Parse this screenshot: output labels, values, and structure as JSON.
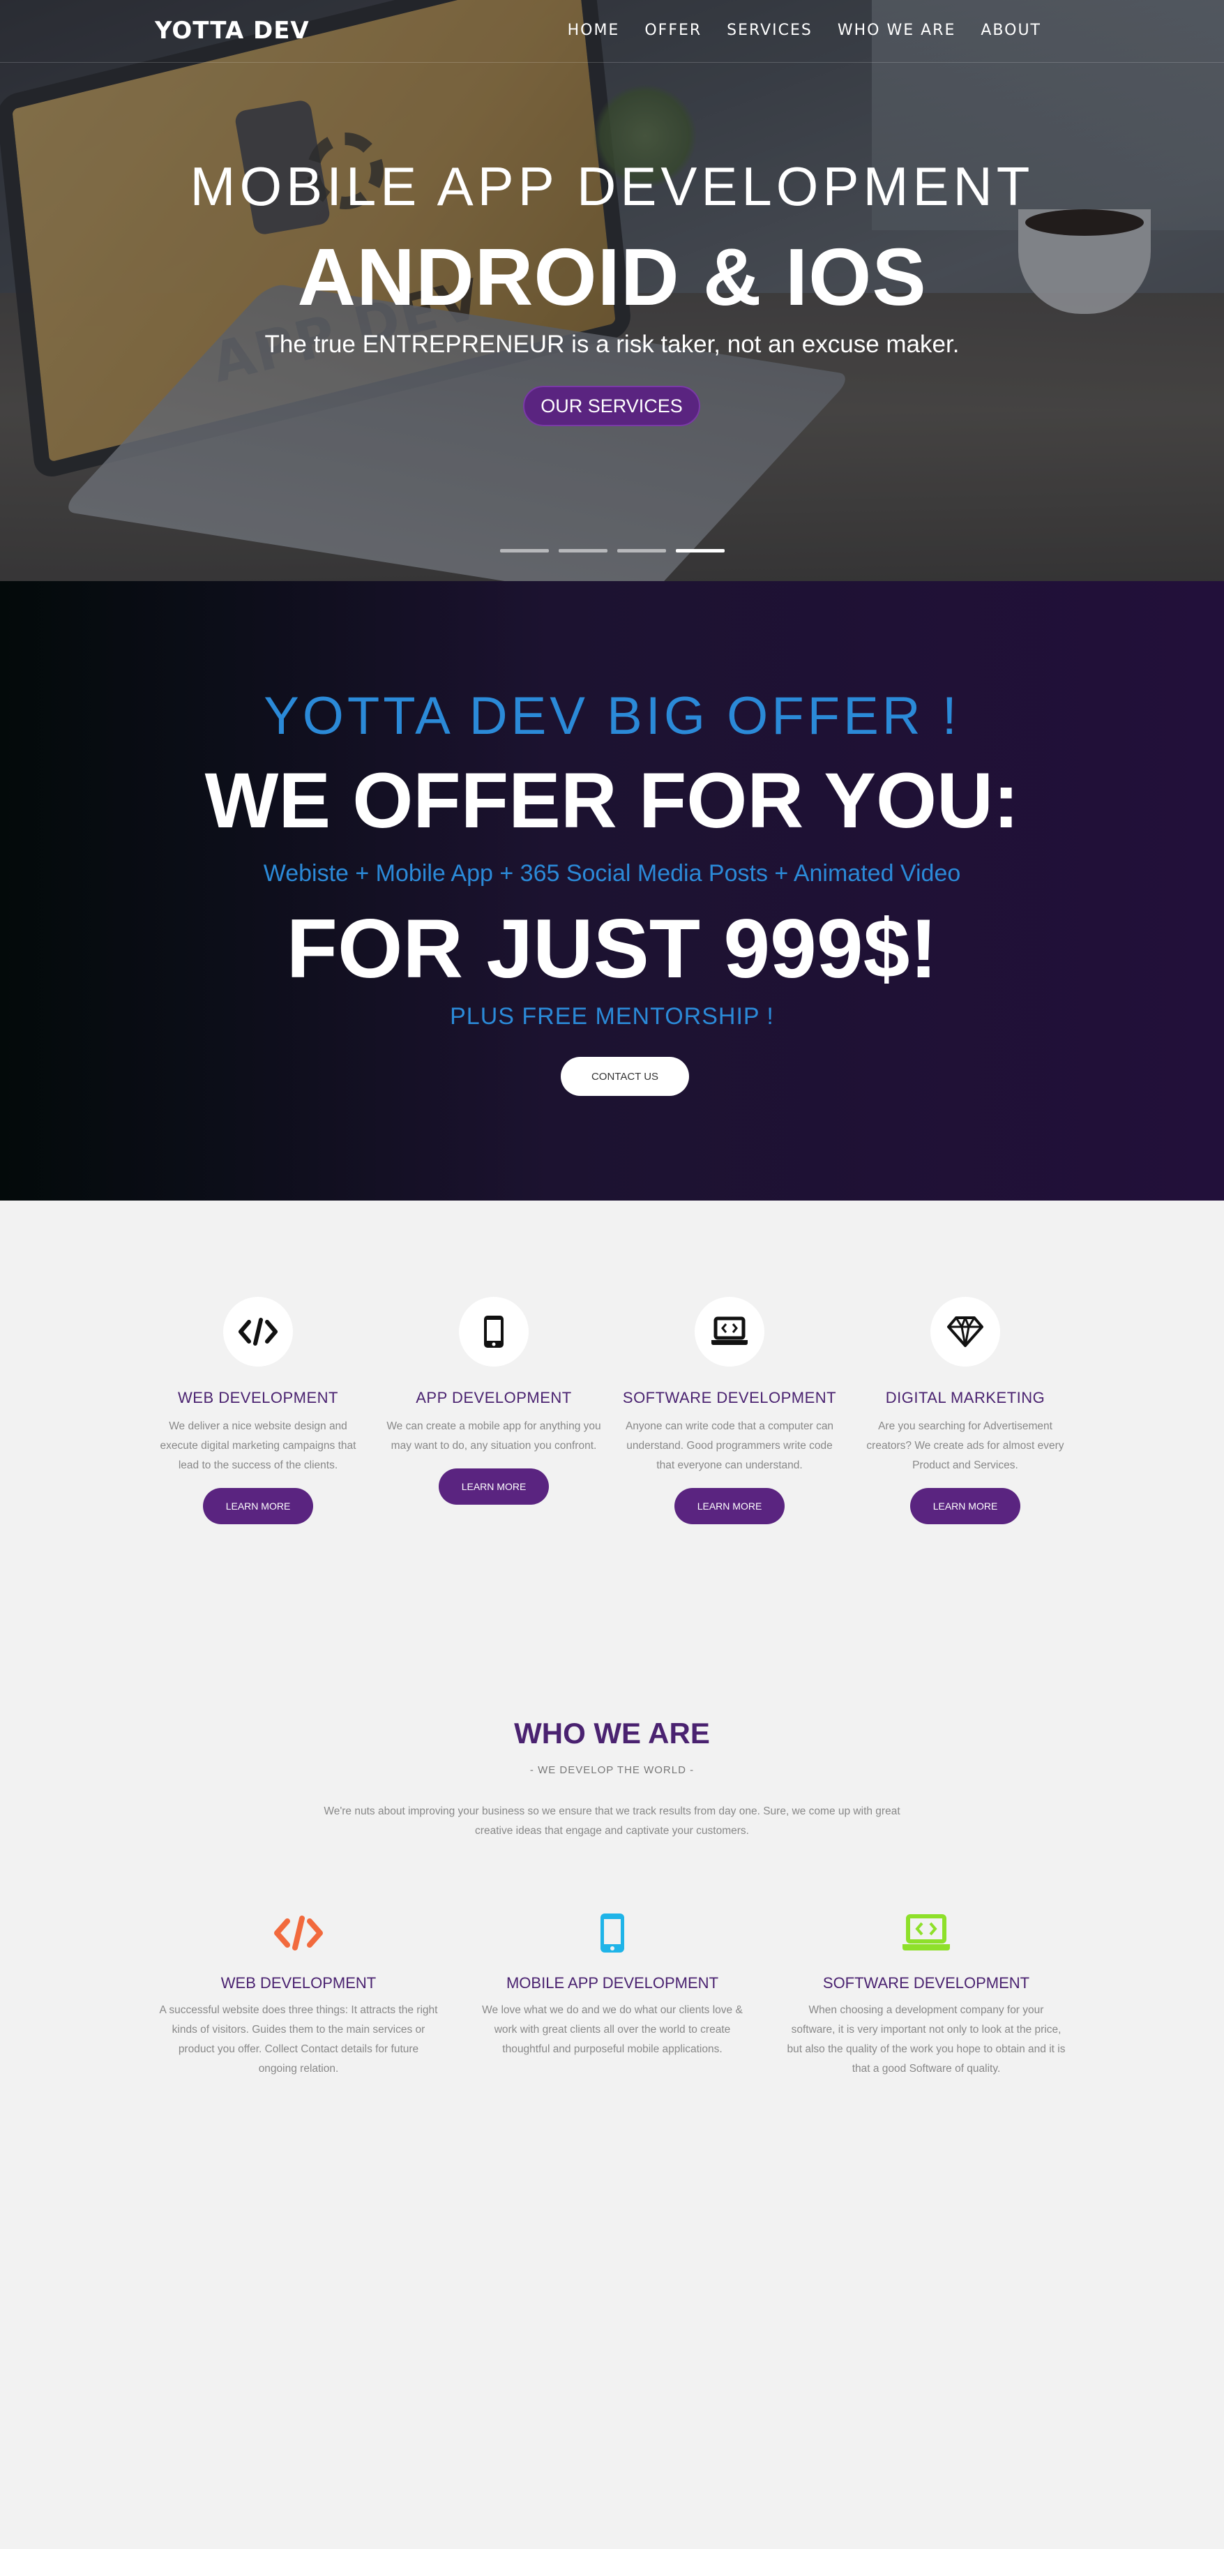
{
  "brand": "YOTTA DEV",
  "nav": [
    "HOME",
    "OFFER",
    "SERVICES",
    "WHO WE ARE",
    "ABOUT"
  ],
  "hero": {
    "kicker": "MOBILE APP DEVELOPMENT",
    "title": "ANDROID & IOS",
    "subtitle": "The true ENTREPRENEUR is a risk taker, not an excuse maker.",
    "button": "OUR SERVICES",
    "image_text": "APP DEV",
    "slides_total": 4,
    "active_slide": 4
  },
  "offer": {
    "kicker": "YOTTA DEV BIG OFFER !",
    "title": "WE OFFER FOR YOU:",
    "line": "Webiste + Mobile App + 365 Social Media Posts + Animated Video",
    "price": "FOR JUST 999$!",
    "mentorship": "PLUS FREE MENTORSHIP !",
    "button": "CONTACT US",
    "accent_color": "#2b8ad8"
  },
  "services": [
    {
      "icon": "code-icon",
      "title": "WEB DEVELOPMENT",
      "text": "We deliver a nice website design and execute digital marketing campaigns that lead to the success of the clients.",
      "button": "LEARN MORE"
    },
    {
      "icon": "mobile-icon",
      "title": "APP DEVELOPMENT",
      "text": "We can create a mobile app for anything you may want to do, any situation you confront.",
      "button": "LEARN MORE"
    },
    {
      "icon": "laptop-code-icon",
      "title": "SOFTWARE DEVELOPMENT",
      "text": "Anyone can write code that a computer can understand. Good programmers write code that everyone can understand.",
      "button": "LEARN MORE"
    },
    {
      "icon": "diamond-icon",
      "title": "DIGITAL MARKETING",
      "text": "Are you searching for Advertisement creators? We create ads for almost every Product and Services.",
      "button": "LEARN MORE"
    }
  ],
  "who": {
    "title": "WHO WE ARE",
    "tagline": "- WE DEVELOP THE WORLD -",
    "intro": "We're nuts about improving your business so we ensure that we track results from day one. Sure, we come up with great creative ideas that engage and captivate your customers.",
    "features": [
      {
        "icon": "code-icon",
        "color": "#f26a3d",
        "title": "WEB DEVELOPMENT",
        "text": "A successful website does three things: It attracts the right kinds of visitors. Guides them to the main services or product you offer. Collect Contact details for future ongoing relation."
      },
      {
        "icon": "mobile-icon",
        "color": "#1fb4e8",
        "title": "MOBILE APP DEVELOPMENT",
        "text": "We love what we do and we do what our clients love & work with great clients all over the world to create thoughtful and purposeful mobile applications."
      },
      {
        "icon": "laptop-code-icon",
        "color": "#8ee02a",
        "title": "SOFTWARE DEVELOPMENT",
        "text": "When choosing a development company for your software, it is very important not only to look at the price, but also the quality of the work you hope to obtain and it is that a good Software of quality."
      }
    ]
  },
  "colors": {
    "brand_purple": "#5a2480",
    "heading_purple": "#4a2270"
  }
}
